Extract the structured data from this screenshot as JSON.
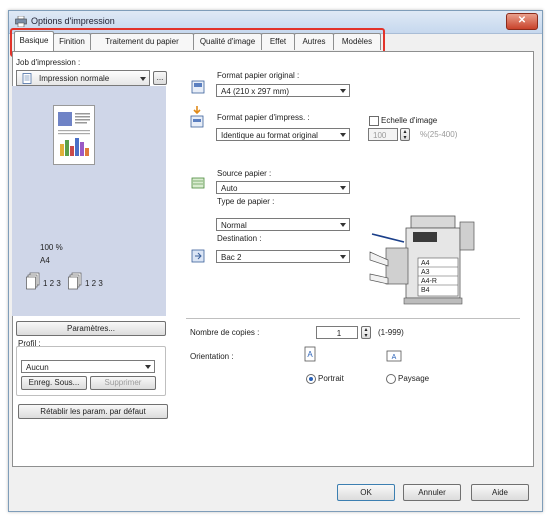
{
  "window": {
    "title": "Options d'impression",
    "close_glyph": "✕"
  },
  "tabs": [
    {
      "label": "Basique",
      "active": true
    },
    {
      "label": "Finition"
    },
    {
      "label": "Traitement du papier"
    },
    {
      "label": "Qualité d'image"
    },
    {
      "label": "Effet"
    },
    {
      "label": "Autres"
    },
    {
      "label": "Modèles"
    }
  ],
  "left": {
    "job_label": "Job d'impression :",
    "job_value": "Impression normale",
    "more_button": "...",
    "preview": {
      "zoom": "100 %",
      "paper": "A4",
      "collate_1": "1 2 3",
      "collate_2": "1 2 3"
    },
    "parametres_button": "Paramètres...",
    "profil_label": "Profil :",
    "profil_value": "Aucun",
    "save_button": "Enreg. Sous...",
    "delete_button": "Supprimer",
    "reset_button": "Rétablir les param. par défaut"
  },
  "right": {
    "original_label": "Format papier original :",
    "original_value": "A4 (210 x 297 mm)",
    "print_label": "Format papier d'impress. :",
    "print_value": "Identique au format original",
    "scale_label": "Echelle d'image",
    "scale_value": "100",
    "scale_range": "%(25-400)",
    "source_label": "Source papier :",
    "source_value": "Auto",
    "type_label": "Type de papier :",
    "type_value": "Normal",
    "dest_label": "Destination :",
    "dest_value": "Bac 2",
    "printer_trays": [
      "A4",
      "A3",
      "A4-R",
      "B4"
    ],
    "copies_label": "Nombre de copies :",
    "copies_value": "1",
    "copies_range": "(1-999)",
    "orientation_label": "Orientation :",
    "portrait_label": "Portrait",
    "landscape_label": "Paysage"
  },
  "footer": {
    "ok": "OK",
    "cancel": "Annuler",
    "help": "Aide"
  },
  "colors": {
    "highlight": "#e2332a",
    "preview_bg": "#cfd6e8",
    "accent": "#2a62b8"
  }
}
